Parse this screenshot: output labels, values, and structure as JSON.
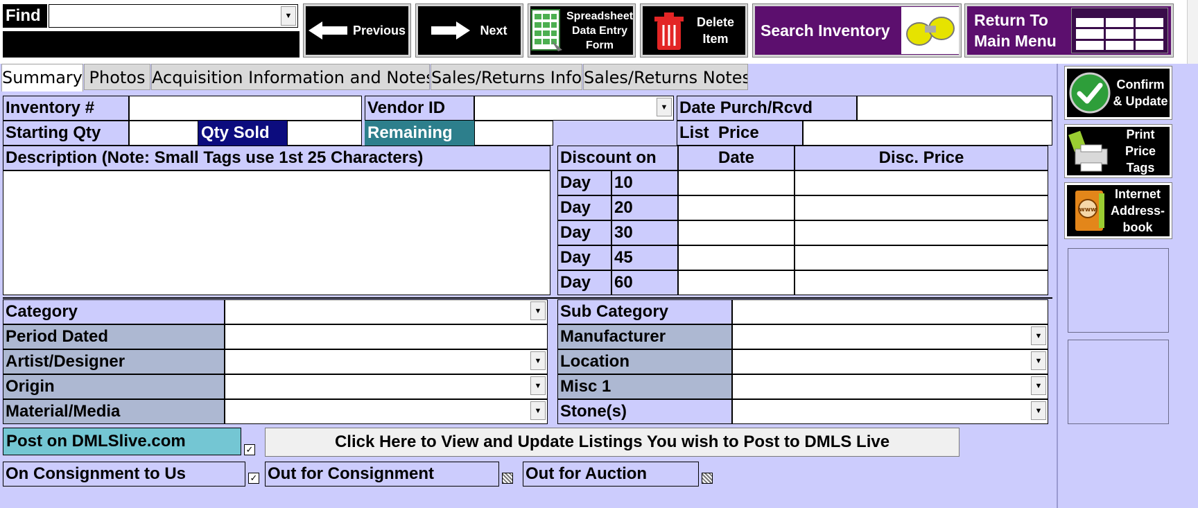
{
  "toolbar": {
    "find_label": "Find",
    "find_value": "",
    "previous_label": "Previous",
    "next_label": "Next",
    "spreadsheet_label": "Spreadsheet Data Entry Form",
    "delete_label": "Delete Item",
    "search_inventory_label": "Search Inventory",
    "return_label": "Return To Main Menu"
  },
  "tabs": [
    {
      "label": "Summary",
      "active": true
    },
    {
      "label": "Photos",
      "active": false
    },
    {
      "label": "Acquisition Information and Notes",
      "active": false
    },
    {
      "label": "Sales/Returns Info",
      "active": false
    },
    {
      "label": "Sales/Returns Notes",
      "active": false
    }
  ],
  "form": {
    "inventory_label": "Inventory #",
    "vendor_label": "Vendor ID",
    "date_purch_label": "Date Purch/Rcvd",
    "starting_qty_label": "Starting Qty",
    "qty_sold_label": "Qty Sold",
    "remaining_label": "Remaining",
    "list_price_label": "List  Price",
    "description_label": "Description (Note: Small Tags use 1st 25 Characters)"
  },
  "discount": {
    "col_discount": "Discount on",
    "col_date": "Date",
    "col_price": "Disc. Price",
    "rows": [
      {
        "day": "Day",
        "num": "10"
      },
      {
        "day": "Day",
        "num": "20"
      },
      {
        "day": "Day",
        "num": "30"
      },
      {
        "day": "Day",
        "num": "45"
      },
      {
        "day": "Day",
        "num": "60"
      }
    ]
  },
  "attributes": {
    "category": "Category",
    "period_dated": "Period Dated",
    "artist": "Artist/Designer",
    "origin": "Origin",
    "material": "Material/Media",
    "sub_category": "Sub Category",
    "manufacturer": "Manufacturer",
    "location": "Location",
    "misc1": "Misc 1",
    "stones": "Stone(s)"
  },
  "bottom": {
    "post_dmls_label": "Post on DMLSlive.com",
    "post_dmls_checked": true,
    "view_listings_label": "Click Here to View and Update Listings You wish to Post to DMLS Live",
    "on_consignment_label": "On Consignment to Us",
    "on_consignment_checked": true,
    "out_consignment_label": "Out for Consignment",
    "out_auction_label": "Out for Auction"
  },
  "side": {
    "confirm_label": "Confirm & Update",
    "print_label": "Print Price Tags",
    "addressbook_label": "Internet Address-book"
  },
  "colors": {
    "background": "#ccccfd",
    "label_blue": "#adb8d2",
    "qty_sold_bg": "#0c0c7e",
    "remaining_bg": "#2d7f8c",
    "post_dmls_bg": "#74c6d3",
    "purple_btn": "#5c0f6e"
  }
}
